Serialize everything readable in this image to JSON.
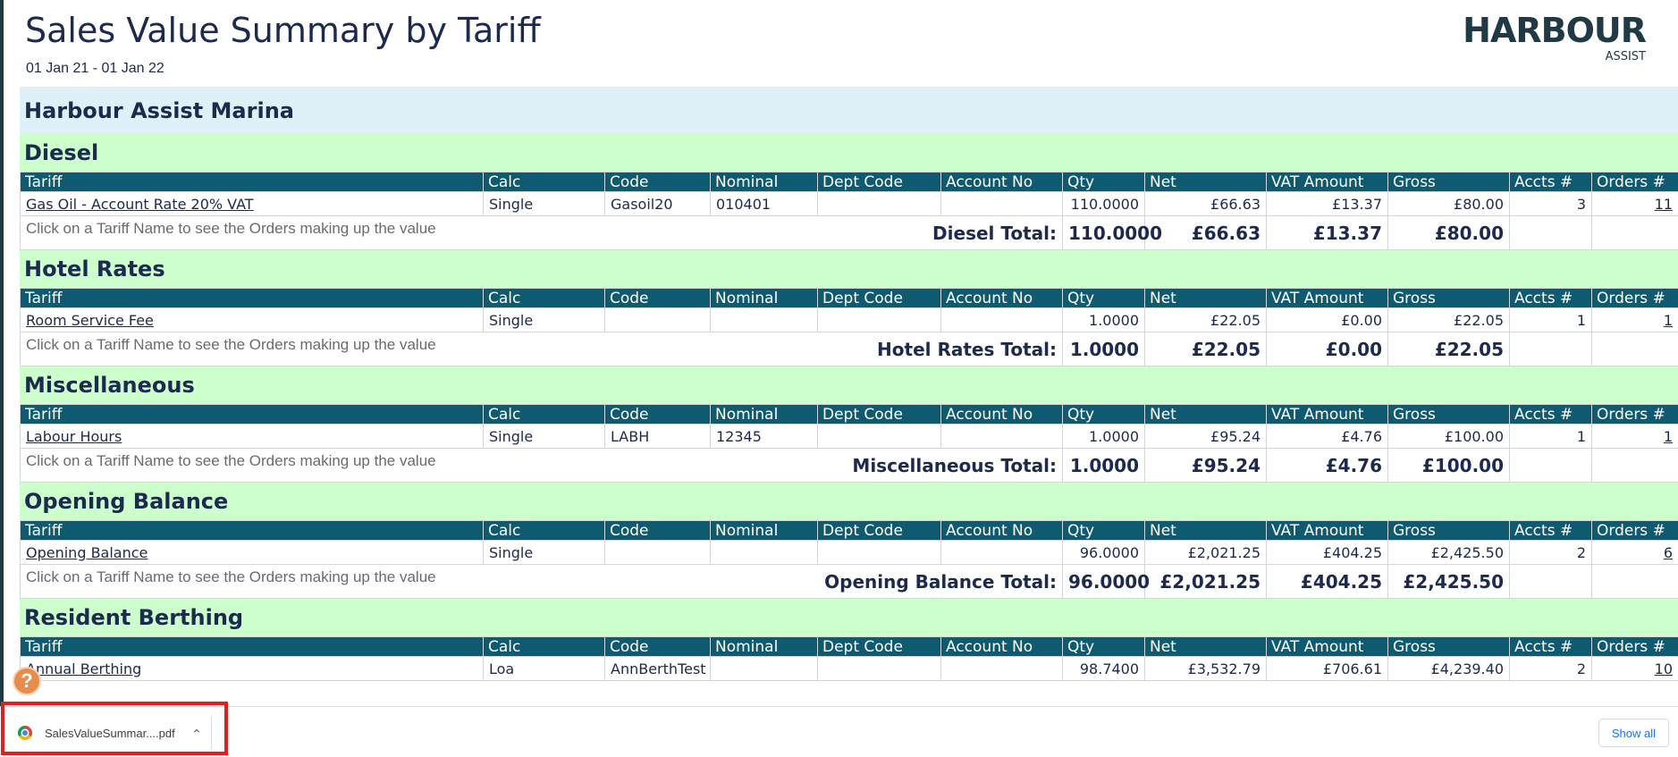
{
  "report": {
    "title": "Sales Value Summary by Tariff",
    "dates": "01 Jan 21 - 01 Jan 22",
    "logo_main": "HARBOUR",
    "logo_sub": "ASSIST",
    "company": "Harbour Assist Marina"
  },
  "columns": [
    "Tariff",
    "Calc",
    "Code",
    "Nominal",
    "Dept Code",
    "Account No",
    "Qty",
    "Net",
    "VAT Amount",
    "Gross",
    "Accts #",
    "Orders #"
  ],
  "hint": "Click on a Tariff Name to see the Orders making up the value",
  "groups": [
    {
      "name": "Diesel",
      "row": {
        "tariff": "Gas Oil - Account Rate 20% VAT",
        "calc": "Single",
        "code": "Gasoil20",
        "nominal": "010401",
        "dept": "",
        "account": "",
        "qty": "110.0000",
        "net": "£66.63",
        "vat": "£13.37",
        "gross": "£80.00",
        "accts": "3",
        "orders": "11"
      },
      "total": {
        "label": "Diesel Total:",
        "qty": "110.0000",
        "net": "£66.63",
        "vat": "£13.37",
        "gross": "£80.00"
      }
    },
    {
      "name": "Hotel Rates",
      "row": {
        "tariff": "Room Service Fee",
        "calc": "Single",
        "code": "",
        "nominal": "",
        "dept": "",
        "account": "",
        "qty": "1.0000",
        "net": "£22.05",
        "vat": "£0.00",
        "gross": "£22.05",
        "accts": "1",
        "orders": "1"
      },
      "total": {
        "label": "Hotel Rates Total:",
        "qty": "1.0000",
        "net": "£22.05",
        "vat": "£0.00",
        "gross": "£22.05"
      }
    },
    {
      "name": "Miscellaneous",
      "row": {
        "tariff": "Labour Hours",
        "calc": "Single",
        "code": "LABH",
        "nominal": "12345",
        "dept": "",
        "account": "",
        "qty": "1.0000",
        "net": "£95.24",
        "vat": "£4.76",
        "gross": "£100.00",
        "accts": "1",
        "orders": "1"
      },
      "total": {
        "label": "Miscellaneous Total:",
        "qty": "1.0000",
        "net": "£95.24",
        "vat": "£4.76",
        "gross": "£100.00"
      }
    },
    {
      "name": "Opening Balance",
      "row": {
        "tariff": "Opening Balance",
        "calc": "Single",
        "code": "",
        "nominal": "",
        "dept": "",
        "account": "",
        "qty": "96.0000",
        "net": "£2,021.25",
        "vat": "£404.25",
        "gross": "£2,425.50",
        "accts": "2",
        "orders": "6"
      },
      "total": {
        "label": "Opening Balance Total:",
        "qty": "96.0000",
        "net": "£2,021.25",
        "vat": "£404.25",
        "gross": "£2,425.50"
      }
    },
    {
      "name": "Resident Berthing",
      "row": {
        "tariff": "Annual Berthing",
        "calc": "Loa",
        "code": "AnnBerthTest",
        "nominal": "",
        "dept": "",
        "account": "",
        "qty": "98.7400",
        "net": "£3,532.79",
        "vat": "£706.61",
        "gross": "£4,239.40",
        "accts": "2",
        "orders": "10"
      }
    }
  ],
  "help": {
    "glyph": "?"
  },
  "downloads": {
    "file_name": "SalesValueSummar....pdf",
    "chevron": "⌄",
    "show_all": "Show all",
    "icon": "chrome-icon"
  }
}
